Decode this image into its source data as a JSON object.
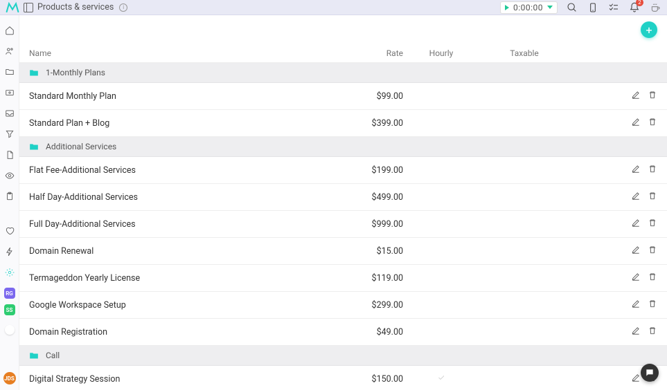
{
  "header": {
    "title": "Products & services",
    "timer": "0:00:00",
    "notification_count": "2"
  },
  "sidebar": {
    "badges": [
      {
        "text": "RG",
        "color": "purple"
      },
      {
        "text": "SS",
        "color": "green"
      }
    ],
    "avatar": "JDS"
  },
  "columns": {
    "name": "Name",
    "rate": "Rate",
    "hourly": "Hourly",
    "taxable": "Taxable"
  },
  "groups": [
    {
      "label": "1-Monthly Plans",
      "items": [
        {
          "name": "Standard Monthly Plan",
          "rate": "$99.00",
          "hourly": false
        },
        {
          "name": "Standard Plan + Blog",
          "rate": "$399.00",
          "hourly": false
        }
      ]
    },
    {
      "label": "Additional Services",
      "items": [
        {
          "name": "Flat Fee-Additional Services",
          "rate": "$199.00",
          "hourly": false
        },
        {
          "name": "Half Day-Additional Services",
          "rate": "$499.00",
          "hourly": false
        },
        {
          "name": "Full Day-Additional Services",
          "rate": "$999.00",
          "hourly": false
        },
        {
          "name": "Domain Renewal",
          "rate": "$15.00",
          "hourly": false
        },
        {
          "name": "Termageddon Yearly License",
          "rate": "$119.00",
          "hourly": false
        },
        {
          "name": "Google Workspace Setup",
          "rate": "$299.00",
          "hourly": false
        },
        {
          "name": "Domain Registration",
          "rate": "$49.00",
          "hourly": false
        }
      ]
    },
    {
      "label": "Call",
      "items": [
        {
          "name": "Digital Strategy Session",
          "rate": "$150.00",
          "hourly": true
        }
      ]
    }
  ],
  "icons": {
    "add": "+"
  }
}
